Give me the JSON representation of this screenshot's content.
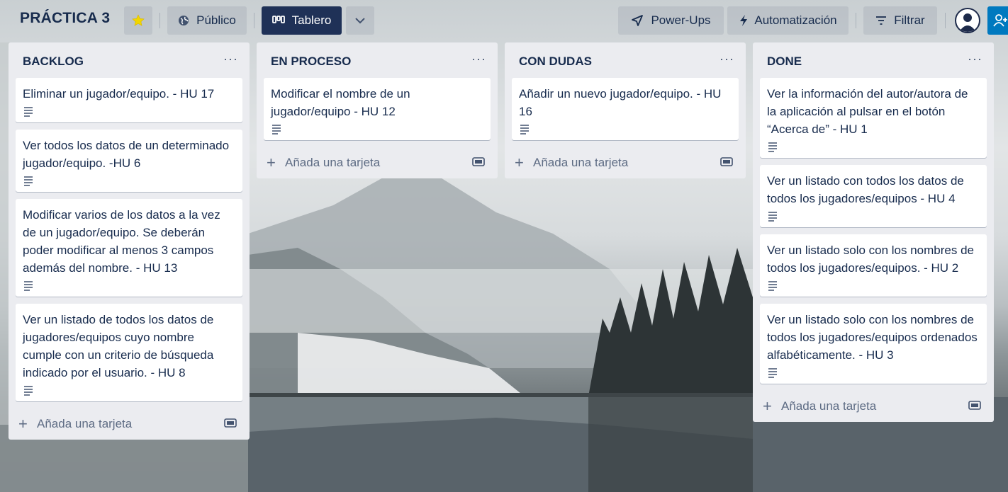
{
  "board": {
    "title": "PRÁCTICA 3",
    "visibility_label": "Público",
    "view_label": "Tablero",
    "powerups_label": "Power-Ups",
    "automation_label": "Automatización",
    "filter_label": "Filtrar"
  },
  "lists": [
    {
      "title": "BACKLOG",
      "menu": "···",
      "cards": [
        {
          "text": "Eliminar un jugador/equipo. - HU 17"
        },
        {
          "text": "Ver todos los datos de un determinado jugador/equipo. -HU 6"
        },
        {
          "text": "Modificar varios de los datos a la vez de un jugador/equipo. Se deberán poder modificar al menos 3 campos además del nombre. - HU 13"
        },
        {
          "text": "Ver un listado de todos los datos de jugadores/equipos cuyo nombre cumple con un criterio de búsqueda indicado por el usuario. - HU 8"
        }
      ],
      "add_label": "Añada una tarjeta"
    },
    {
      "title": "EN PROCESO",
      "menu": "···",
      "cards": [
        {
          "text": "Modificar el nombre de un jugador/equipo - HU 12"
        }
      ],
      "add_label": "Añada una tarjeta"
    },
    {
      "title": "CON DUDAS",
      "menu": "···",
      "cards": [
        {
          "text": "Añadir un nuevo jugador/equipo. - HU 16"
        }
      ],
      "add_label": "Añada una tarjeta"
    },
    {
      "title": "DONE",
      "menu": "···",
      "cards": [
        {
          "text": "Ver la información del autor/autora de la aplicación al pulsar en el botón “Acerca de” - HU 1"
        },
        {
          "text": "Ver un listado con todos los datos de todos los jugadores/equipos - HU 4"
        },
        {
          "text": "Ver un listado solo con los nombres de todos los jugadores/equipos. - HU 2"
        },
        {
          "text": "Ver un listado solo con los nombres de todos los jugadores/equipos ordenados alfabéticamente. - HU 3"
        }
      ],
      "add_label": "Añada una tarjeta"
    }
  ],
  "colors": {
    "header_dark_button": "#1f3157",
    "list_background": "#ebecf0",
    "invite_button": "#0079bf",
    "star": "#f2d600"
  }
}
